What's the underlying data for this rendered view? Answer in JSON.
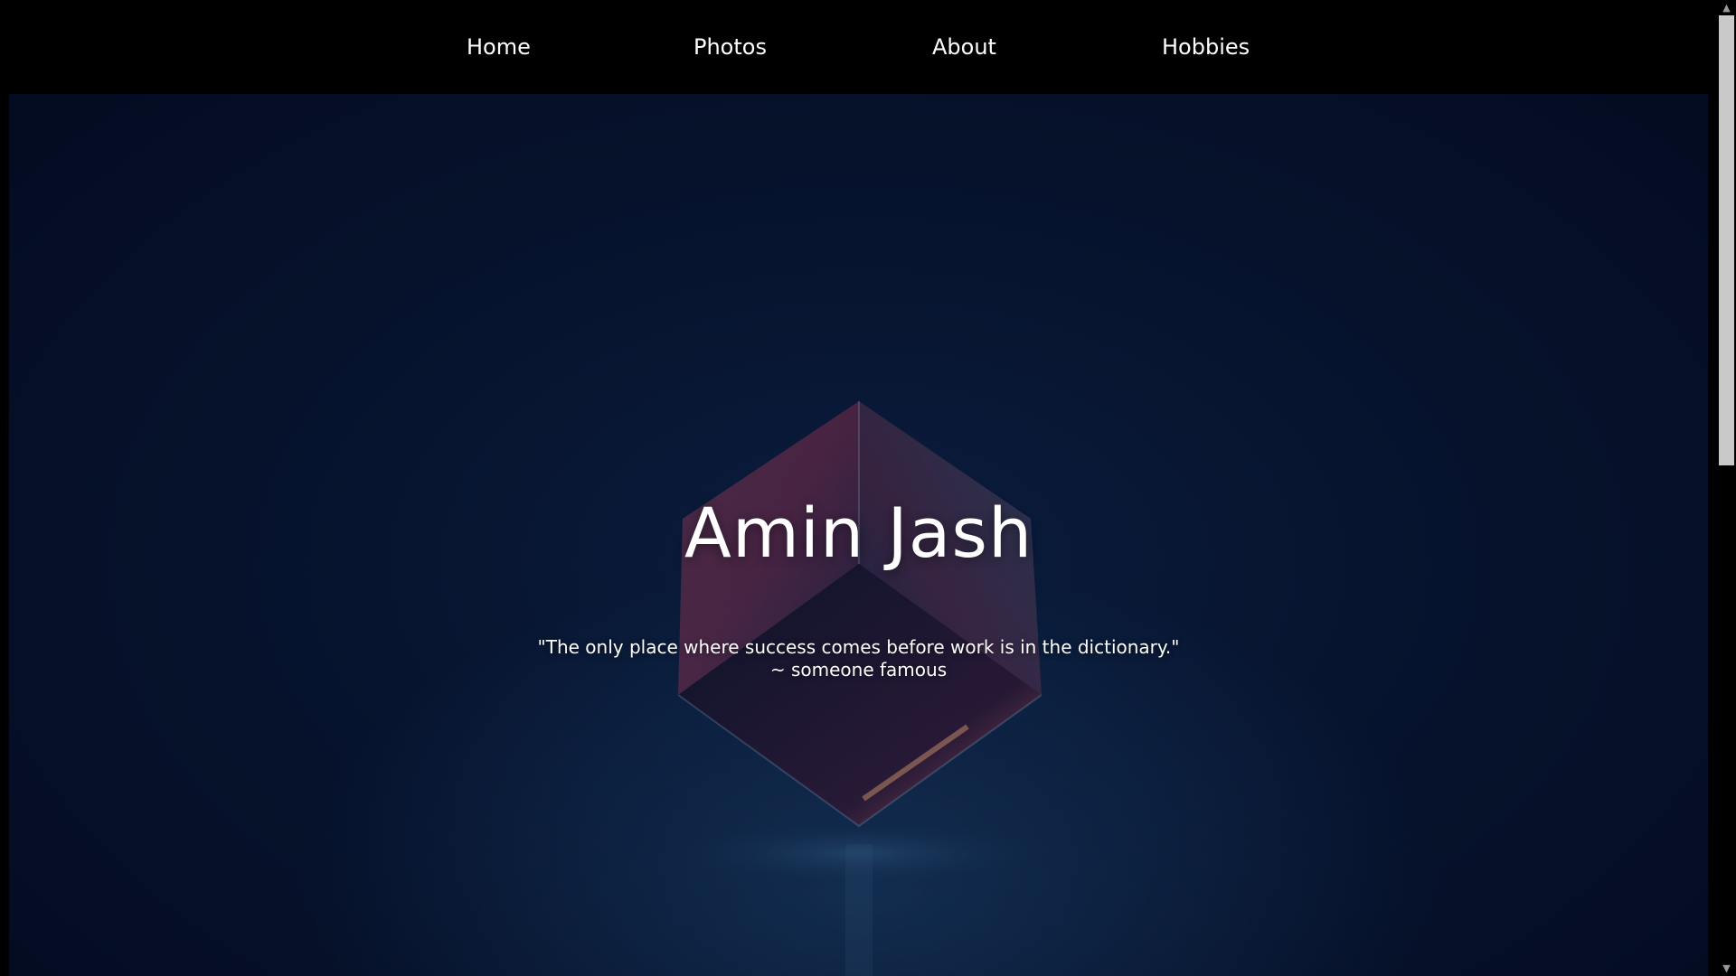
{
  "nav": {
    "items": [
      {
        "label": "Home"
      },
      {
        "label": "Photos"
      },
      {
        "label": "About"
      },
      {
        "label": "Hobbies"
      }
    ]
  },
  "hero": {
    "title": "Amin Jash",
    "quote_line1": "\"The only place where success comes before work is in the dictionary.\"",
    "quote_line2": "~ someone famous"
  },
  "scrollbar": {
    "up_icon": "▲",
    "down_icon": "▼"
  },
  "colors": {
    "background": "#000000",
    "hero_dark": "#040b20",
    "text": "#ffffff"
  }
}
